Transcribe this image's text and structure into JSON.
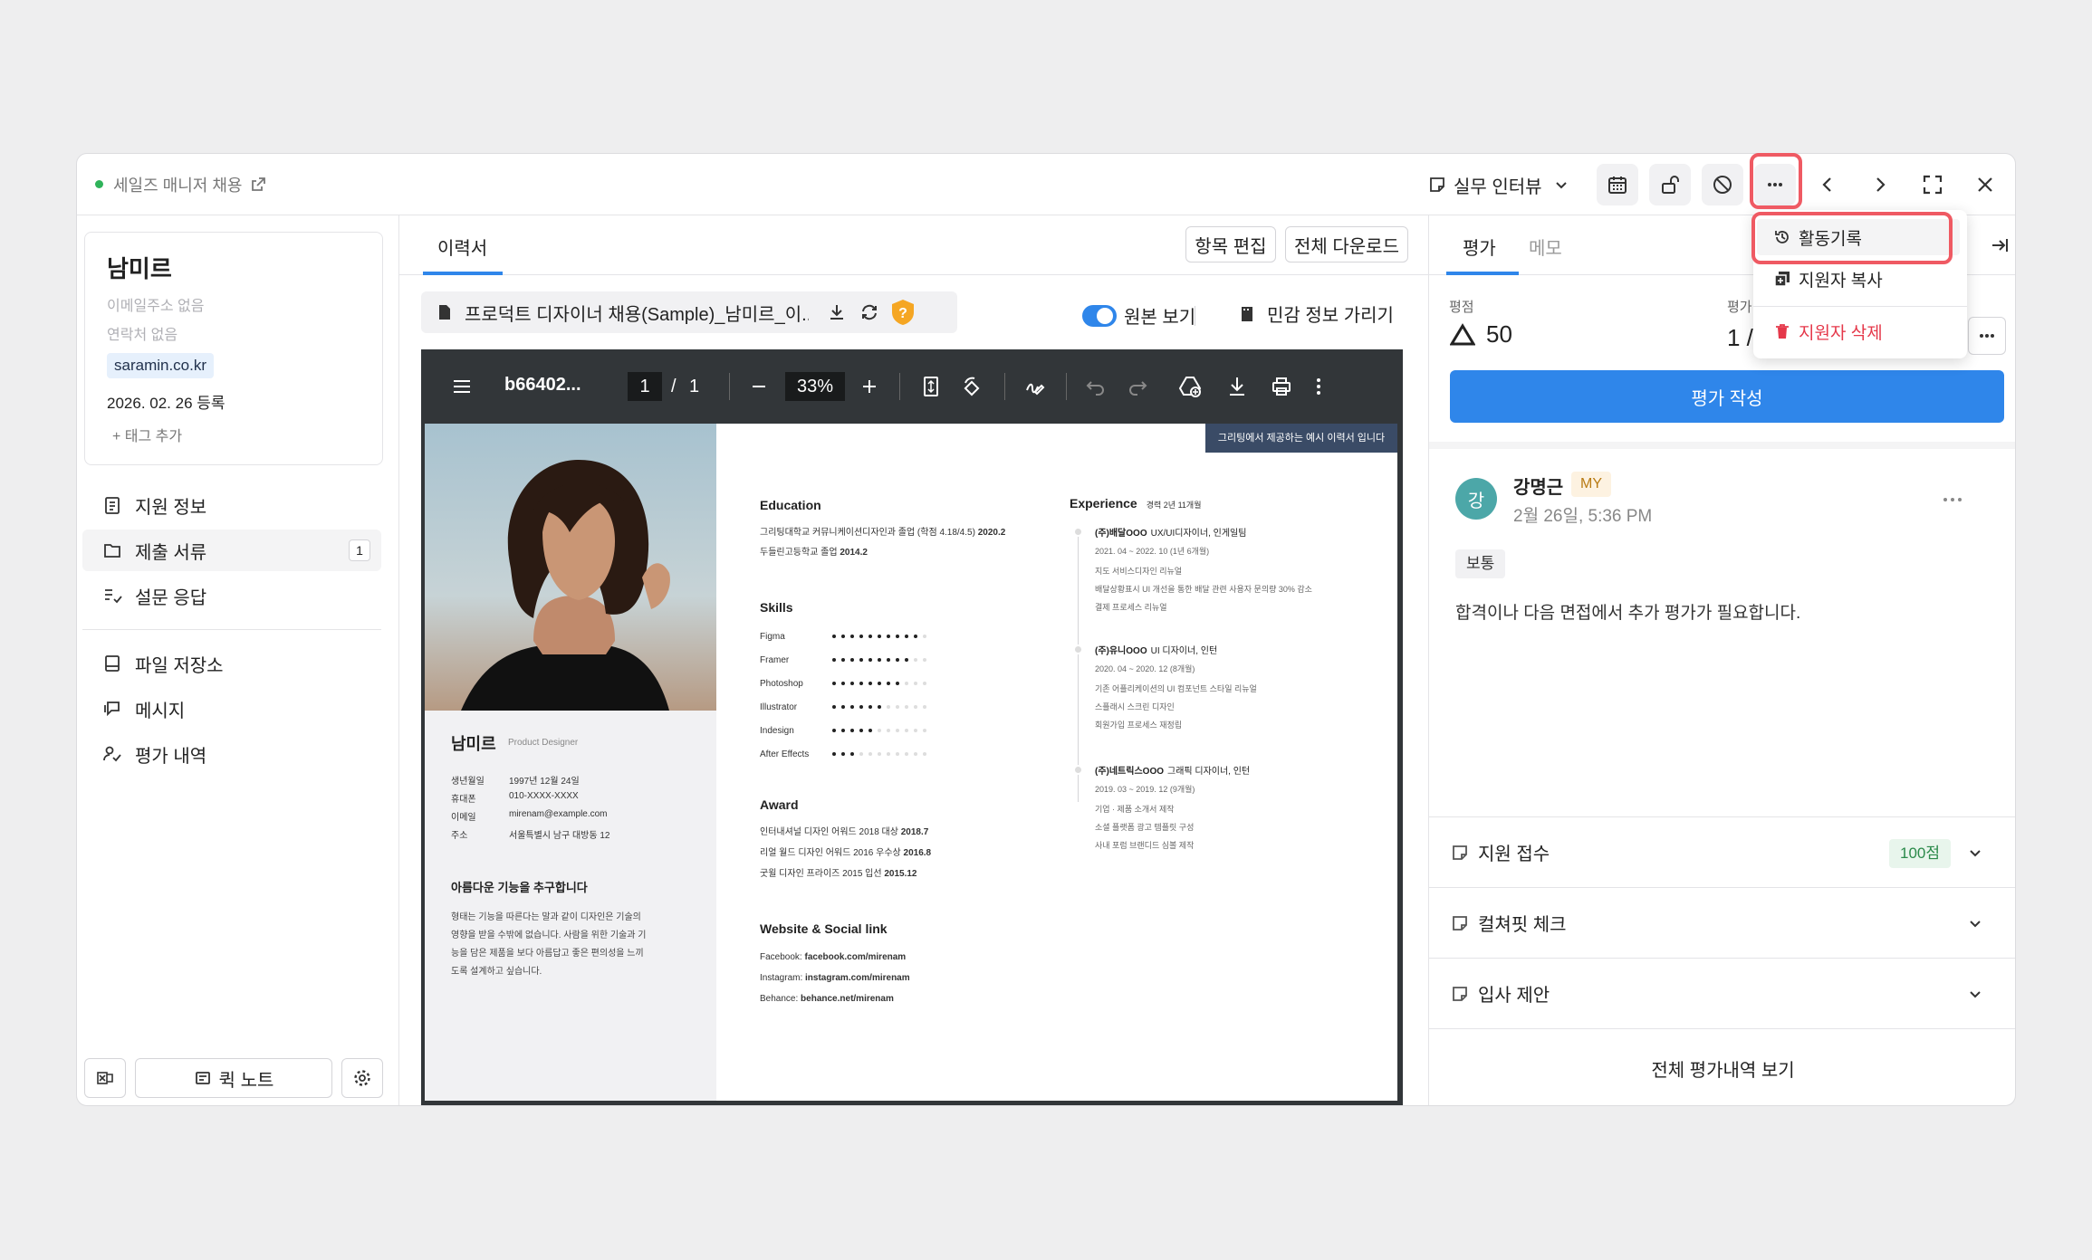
{
  "header": {
    "job_title": "세일즈 매니저 채용",
    "stage_label": "실무 인터뷰"
  },
  "candidate": {
    "name": "남미르",
    "email": "이메일주소 없음",
    "phone": "연락처 없음",
    "source": "saramin.co.kr",
    "date": "2026. 02. 26",
    "date_suffix": "등록",
    "add_tag": "+ 태그 추가"
  },
  "sidebar": {
    "items": [
      {
        "label": "지원 정보"
      },
      {
        "label": "제출 서류",
        "count": "1"
      },
      {
        "label": "설문 응답"
      },
      {
        "label": "파일 저장소"
      },
      {
        "label": "메시지"
      },
      {
        "label": "평가 내역"
      }
    ],
    "quick_note": "퀵 노트"
  },
  "doc": {
    "tab": "이력서",
    "edit_items": "항목 편집",
    "download_all": "전체 다운로드",
    "file_name": "프로덕트 디자이너 채용(Sample)_남미르_이...",
    "original_view": "원본 보기",
    "hide_sensitive": "민감 정보 가리기"
  },
  "pdf": {
    "title": "b66402...",
    "page_current": "1",
    "page_sep": "/",
    "page_total": "1",
    "zoom": "33%"
  },
  "resume": {
    "banner": "그리팅에서 제공하는 예시 이력서 입니다",
    "name": "남미르",
    "role": "Product Designer",
    "info": [
      {
        "k": "생년월일",
        "v": "1997년 12월 24일"
      },
      {
        "k": "휴대폰",
        "v": "010-XXXX-XXXX"
      },
      {
        "k": "이메일",
        "v": "mirenam@example.com"
      },
      {
        "k": "주소",
        "v": "서울특별시 남구 대방동 12"
      }
    ],
    "motto": "아름다운 기능을 추구합니다",
    "motto_body": [
      "형태는 기능을 따른다는 말과 같이 디자인은 기술의",
      "영향을 받을 수밖에 없습니다. 사람을 위한 기술과 기",
      "능을 담은 제품을 보다 아름답고 좋은 편의성을 느끼",
      "도록 설계하고 싶습니다."
    ],
    "education_title": "Education",
    "education": [
      {
        "t": "그리팅대학교 커뮤니케이션디자인과 졸업 (학점 4.18/4.5)",
        "y": "2020.2"
      },
      {
        "t": "두들린고등학교 졸업",
        "y": "2014.2"
      }
    ],
    "skills_title": "Skills",
    "skills": [
      {
        "name": "Figma",
        "level": 10
      },
      {
        "name": "Framer",
        "level": 9
      },
      {
        "name": "Photoshop",
        "level": 8
      },
      {
        "name": "Illustrator",
        "level": 6
      },
      {
        "name": "Indesign",
        "level": 5
      },
      {
        "name": "After Effects",
        "level": 3
      }
    ],
    "award_title": "Award",
    "awards": [
      {
        "t": "인터내셔널 디자인 어워드 2018 대상",
        "y": "2018.7"
      },
      {
        "t": "리얼 월드 디자인 어워드 2016 우수상",
        "y": "2016.8"
      },
      {
        "t": "굿윌 디자인 프라이즈 2015 입선",
        "y": "2015.12"
      }
    ],
    "web_title": "Website & Social link",
    "links": [
      {
        "k": "Facebook:",
        "v": "facebook.com/mirenam"
      },
      {
        "k": "Instagram:",
        "v": "instagram.com/mirenam"
      },
      {
        "k": "Behance:",
        "v": "behance.net/mirenam"
      }
    ],
    "exp_title": "Experience",
    "exp_sub": "경력 2년 11개월",
    "experience": [
      {
        "company": "(주)배달OOO",
        "role": "UX/UI디자이너, 인게일팀",
        "period": "2021. 04 ~ 2022. 10 (1년 6개월)",
        "items": [
          "지도 서비스디자인 리뉴얼",
          "배달상황표시 UI 개선을 통한 배달 관련 사용자 문의량 30% 감소",
          "결제 프로세스 리뉴얼"
        ]
      },
      {
        "company": "(주)유니OOO",
        "role": "UI 디자이너, 인턴",
        "period": "2020. 04 ~ 2020. 12 (8개월)",
        "items": [
          "기존 어플리케이션의 UI 컴포넌트 스타일 리뉴얼",
          "스플래시 스크린 디자인",
          "회원가입 프로세스 재정립"
        ]
      },
      {
        "company": "(주)네트릭스OOO",
        "role": "그래픽 디자이너, 인턴",
        "period": "2019. 03 ~ 2019. 12 (9개월)",
        "items": [
          "기업 · 제품 소개서 제작",
          "소셜 플랫폼 광고 템플릿 구성",
          "사내 포럼 브랜디드 심볼 제작"
        ]
      }
    ]
  },
  "right": {
    "tab_eval": "평가",
    "tab_memo": "메모",
    "score_label": "평점",
    "score": "50",
    "eval_label": "평가",
    "eval_count": "1 /",
    "write_btn": "평가 작성",
    "review": {
      "author": "강명근",
      "badge": "MY",
      "avatar": "강",
      "time": "2월 26일, 5:36 PM",
      "tag": "보통",
      "body": "합격이나 다음 면접에서 추가 평가가 필요합니다."
    },
    "sections": [
      {
        "label": "지원 접수",
        "badge": "100점"
      },
      {
        "label": "컬쳐핏 체크"
      },
      {
        "label": "입사 제안"
      }
    ],
    "view_all": "전체 평가내역 보기"
  },
  "menu": {
    "items": [
      {
        "label": "활동기록"
      },
      {
        "label": "지원자 복사"
      },
      {
        "label": "지원자 삭제"
      }
    ]
  },
  "colors": {
    "primary": "#2f86ea",
    "danger": "#e5384a",
    "highlight": "#ef5a63",
    "green_badge": "#e8f5ec"
  }
}
